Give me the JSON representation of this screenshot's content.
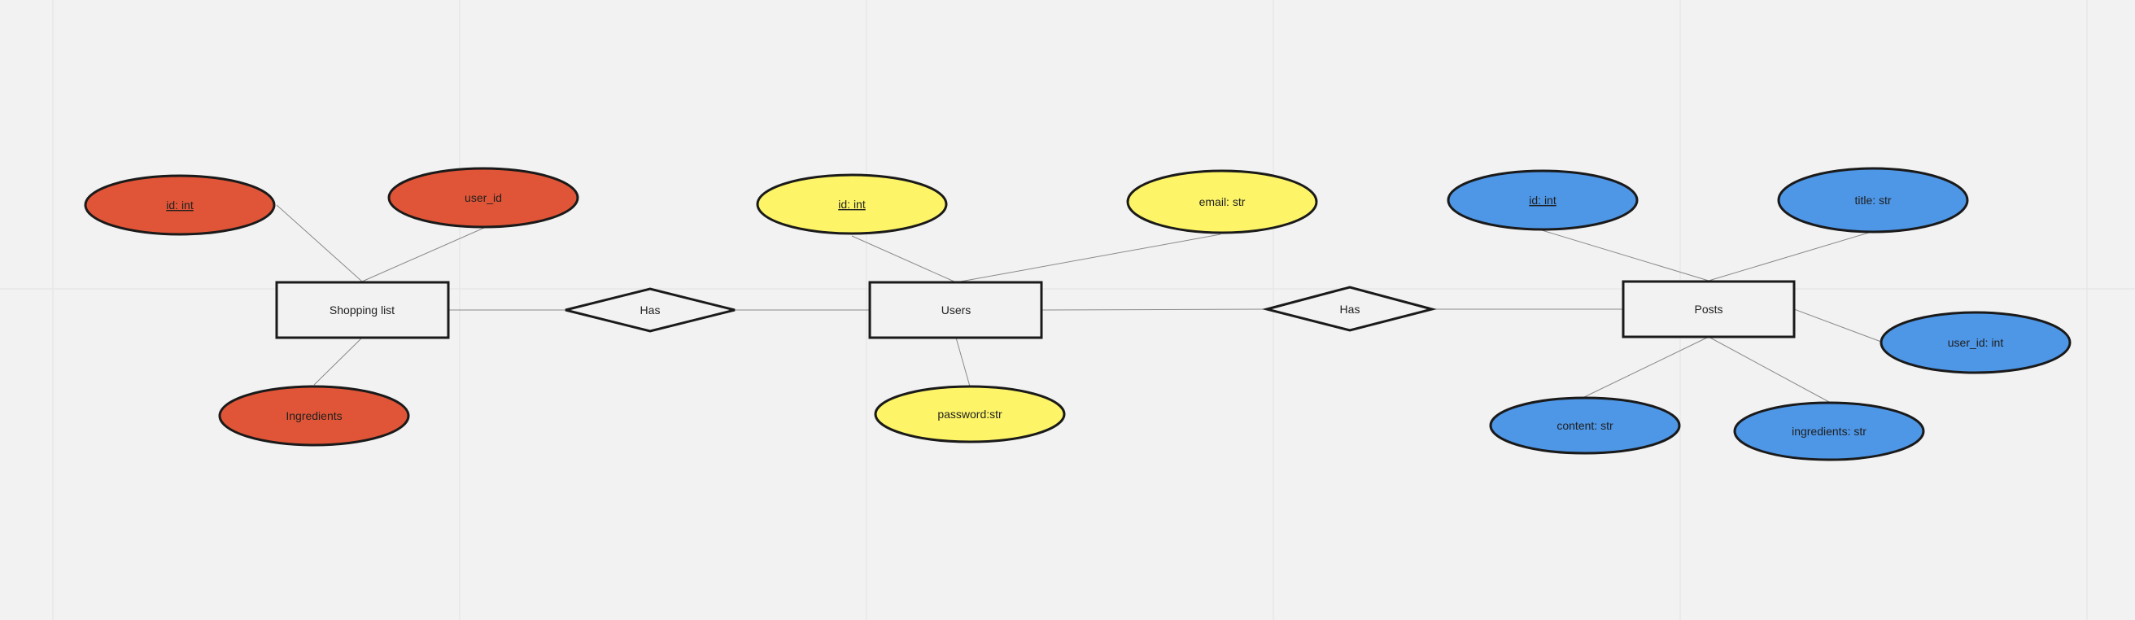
{
  "colors": {
    "background": "#f2f2f2",
    "shopping_attr": "#e05537",
    "users_attr": "#fdf567",
    "posts_attr": "#4e96e6",
    "relationship_fill": "#f2f2f2",
    "entity_fill": "#f2f2f2"
  },
  "entities": {
    "shopping_list": "Shopping list",
    "users": "Users",
    "posts": "Posts"
  },
  "relationships": {
    "shopping_users": "Has",
    "users_posts": "Has"
  },
  "attributes": {
    "shopping": {
      "id": "id: int",
      "user_id": "user_id",
      "ingredients": "Ingredients"
    },
    "users": {
      "id": "id: int",
      "email": "email: str",
      "password": "password:str"
    },
    "posts": {
      "id": "id: int",
      "title": "title: str",
      "user_id": "user_id: int",
      "content": "content: str",
      "ingredients": "ingredients: str"
    }
  }
}
